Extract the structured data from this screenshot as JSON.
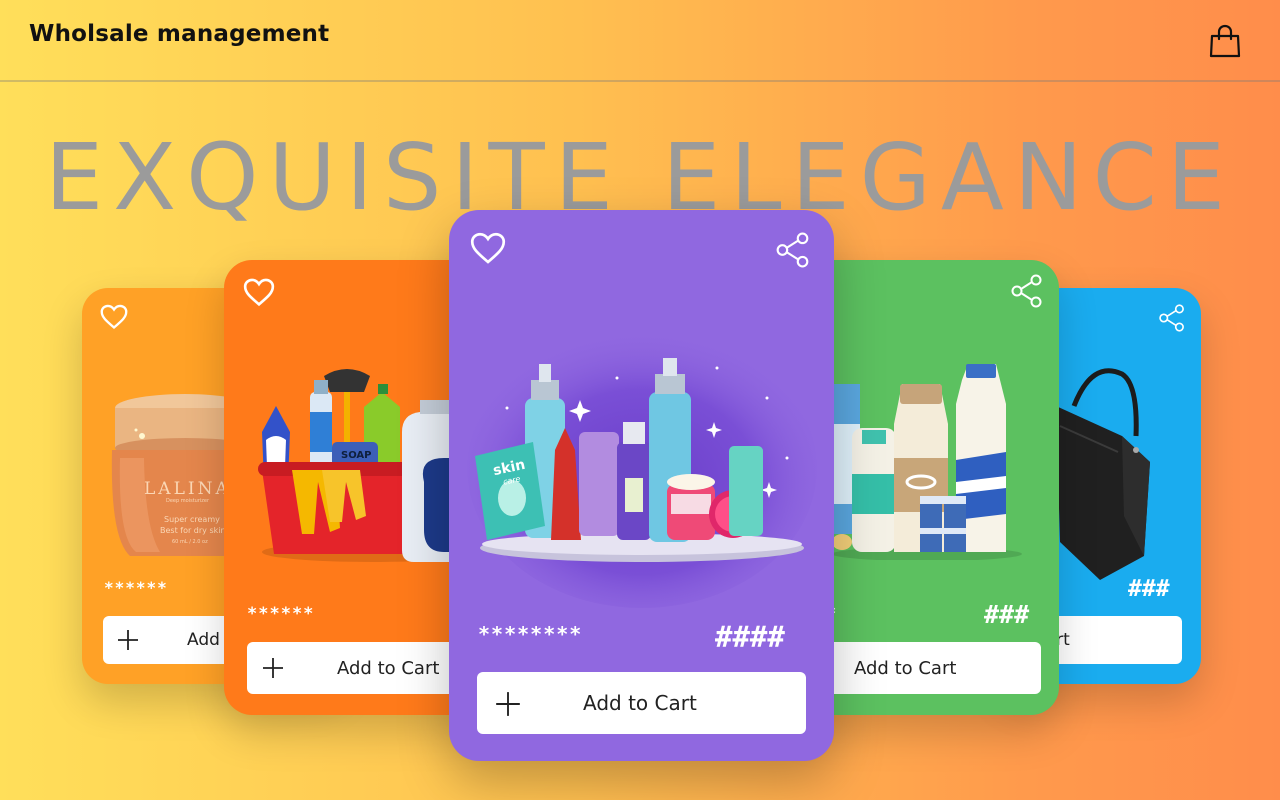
{
  "header": {
    "title": "Wholsale management",
    "cart_icon": "shopping-bag-icon"
  },
  "hero": {
    "text": "EXQUISITE ELEGANCE"
  },
  "cards": [
    {
      "id": "skincare-jar",
      "color": "#ffa126",
      "stars": "******",
      "price": "",
      "add_label": "Add to Cart",
      "product_text": {
        "brand": "LALINA",
        "sub": "Deep moisturizer",
        "line1": "Super creamy",
        "line2": "Best for dry skin",
        "size": "60 mL / 2.0 oz"
      }
    },
    {
      "id": "cleaning-supplies",
      "color": "#ff7a1a",
      "stars": "******",
      "price": "",
      "add_label": "Add to Cart",
      "product_text": {
        "soap": "SOAP"
      }
    },
    {
      "id": "cosmetics",
      "color": "#9068e0",
      "stars": "********",
      "price": "####",
      "add_label": "Add to Cart",
      "product_text": {
        "skin": "skin",
        "care": "care"
      }
    },
    {
      "id": "dairy",
      "color": "#5cc160",
      "stars": "*",
      "price": "###",
      "add_label": "Add to Cart"
    },
    {
      "id": "handbag",
      "color": "#1aacef",
      "stars": "",
      "price": "###",
      "add_label": "Add to Cart"
    }
  ],
  "icons": {
    "favorite": "heart-icon",
    "share": "share-icon",
    "add": "plus-icon"
  }
}
